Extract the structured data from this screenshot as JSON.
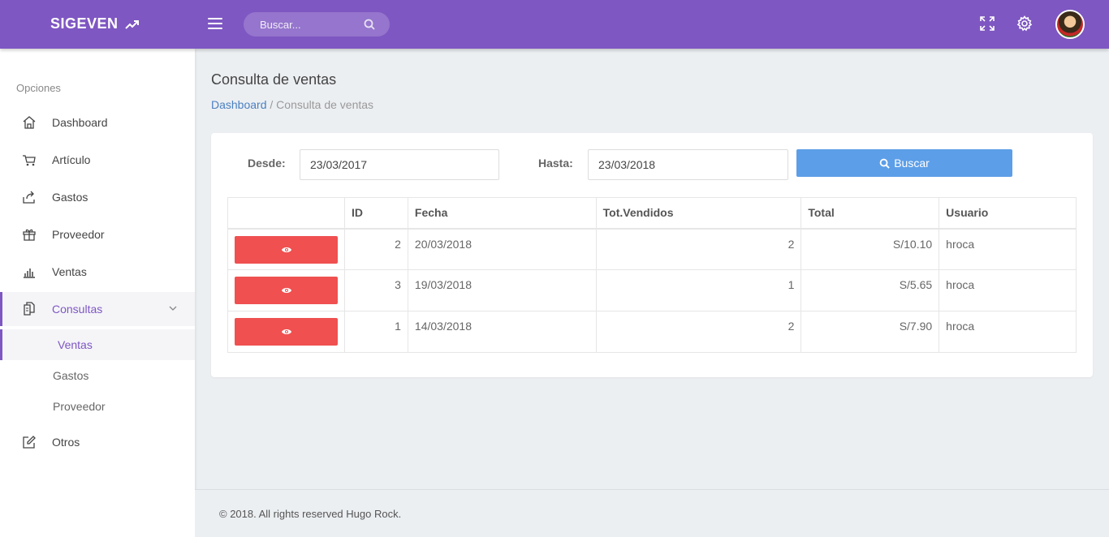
{
  "app": {
    "brand": "SIGEVEN"
  },
  "search": {
    "placeholder": "Buscar..."
  },
  "sidebar": {
    "heading": "Opciones",
    "items": [
      {
        "label": "Dashboard",
        "icon": "home-icon"
      },
      {
        "label": "Artículo",
        "icon": "cart-icon"
      },
      {
        "label": "Gastos",
        "icon": "share-icon"
      },
      {
        "label": "Proveedor",
        "icon": "gift-icon"
      },
      {
        "label": "Ventas",
        "icon": "bar-chart-icon"
      },
      {
        "label": "Consultas",
        "icon": "documents-icon",
        "expanded": true
      },
      {
        "label": "Otros",
        "icon": "edit-icon"
      }
    ],
    "subitems": [
      {
        "label": "Ventas",
        "active": true
      },
      {
        "label": "Gastos"
      },
      {
        "label": "Proveedor"
      }
    ]
  },
  "page": {
    "title": "Consulta de ventas",
    "breadcrumb": {
      "home": "Dashboard",
      "separator": " / ",
      "current": "Consulta de ventas"
    }
  },
  "filters": {
    "desde_label": "Desde:",
    "desde_value": "23/03/2017",
    "hasta_label": "Hasta:",
    "hasta_value": "23/03/2018",
    "search_button": "Buscar"
  },
  "table": {
    "headers": [
      "",
      "ID",
      "Fecha",
      "Tot.Vendidos",
      "Total",
      "Usuario"
    ],
    "rows": [
      {
        "id": "2",
        "fecha": "20/03/2018",
        "vendidos": "2",
        "total": "S/10.10",
        "usuario": "hroca"
      },
      {
        "id": "3",
        "fecha": "19/03/2018",
        "vendidos": "1",
        "total": "S/5.65",
        "usuario": "hroca"
      },
      {
        "id": "1",
        "fecha": "14/03/2018",
        "vendidos": "2",
        "total": "S/7.90",
        "usuario": "hroca"
      }
    ]
  },
  "footer": {
    "text": "© 2018. All rights reserved Hugo Rock."
  },
  "colors": {
    "primary": "#7e57c2",
    "search_button": "#5c9ee8",
    "view_button": "#f05050",
    "link": "#4a7fc1"
  }
}
